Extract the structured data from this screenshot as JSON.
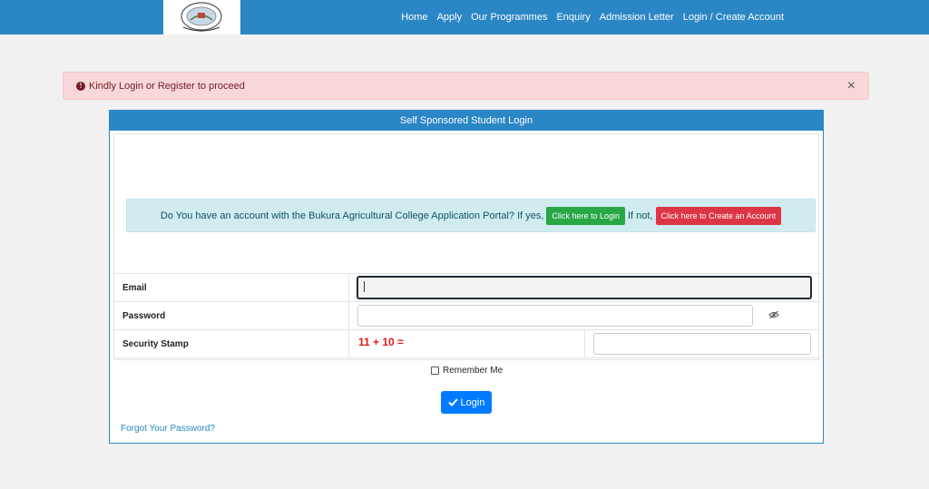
{
  "nav": {
    "links": [
      "Home",
      "Apply",
      "Our Programmes",
      "Enquiry",
      "Admission Letter",
      "Login / Create Account"
    ]
  },
  "alert": {
    "message": "Kindly Login or Register to proceed",
    "icon": "exclamation-circle-icon",
    "close": "×"
  },
  "panel": {
    "title": "Self Sponsored Student Login",
    "info_text": "Do You have an account with the Bukura Agricultural College Application Portal? If yes,",
    "login_here_label": "Click here to Login",
    "if_not_text": "If not,",
    "create_account_label": "Click here to Create an Account"
  },
  "form": {
    "email_label": "Email",
    "email_value": "",
    "password_label": "Password",
    "password_value": "",
    "security_label": "Security Stamp",
    "captcha_text": "11 + 10 =",
    "captcha_answer": "",
    "remember_label": "Remember Me",
    "login_label": "Login",
    "forgot_label": "Forgot Your Password?"
  },
  "colors": {
    "navbar": "#2b86c5",
    "alert_bg": "#f8d7da",
    "info_bg": "#d1ecf1",
    "green": "#28a745",
    "red": "#dc3545",
    "primary": "#007bff"
  }
}
